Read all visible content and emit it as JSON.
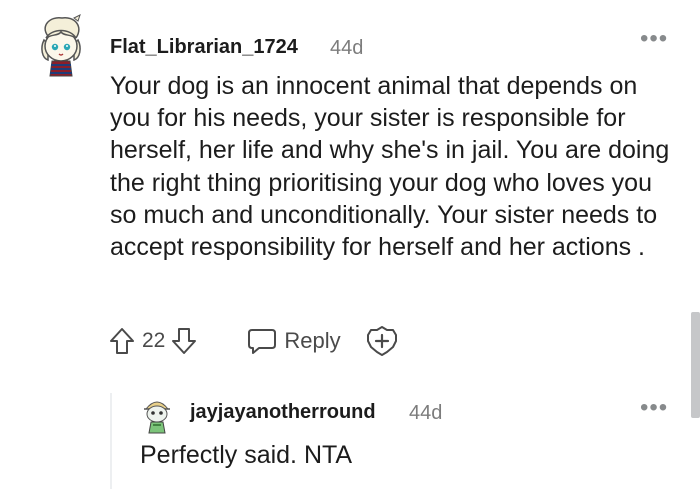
{
  "comment": {
    "username": "Flat_Librarian_1724",
    "timestamp": "44d",
    "more_label": "•••",
    "body": "Your dog is an innocent animal that depends on you for his needs, your sister is responsible for herself, her life and why she's in jail. You are doing the right thing prioritising your dog who loves you so much and unconditionally. Your sister needs to accept responsibility for herself and her actions .",
    "score": "22",
    "reply_label": "Reply",
    "icons": [
      "upvote-icon",
      "downvote-icon",
      "reply-icon",
      "award-icon",
      "more-icon"
    ]
  },
  "reply": {
    "username": "jayjayanotherround",
    "timestamp": "44d",
    "more_label": "•••",
    "body": "Perfectly said. NTA"
  },
  "colors": {
    "text": "#1c1c1c",
    "meta": "#7c7c7c",
    "icon": "#4a4a4a",
    "thread_line": "#edeff1",
    "scrollbar": "#c6c7c9"
  }
}
